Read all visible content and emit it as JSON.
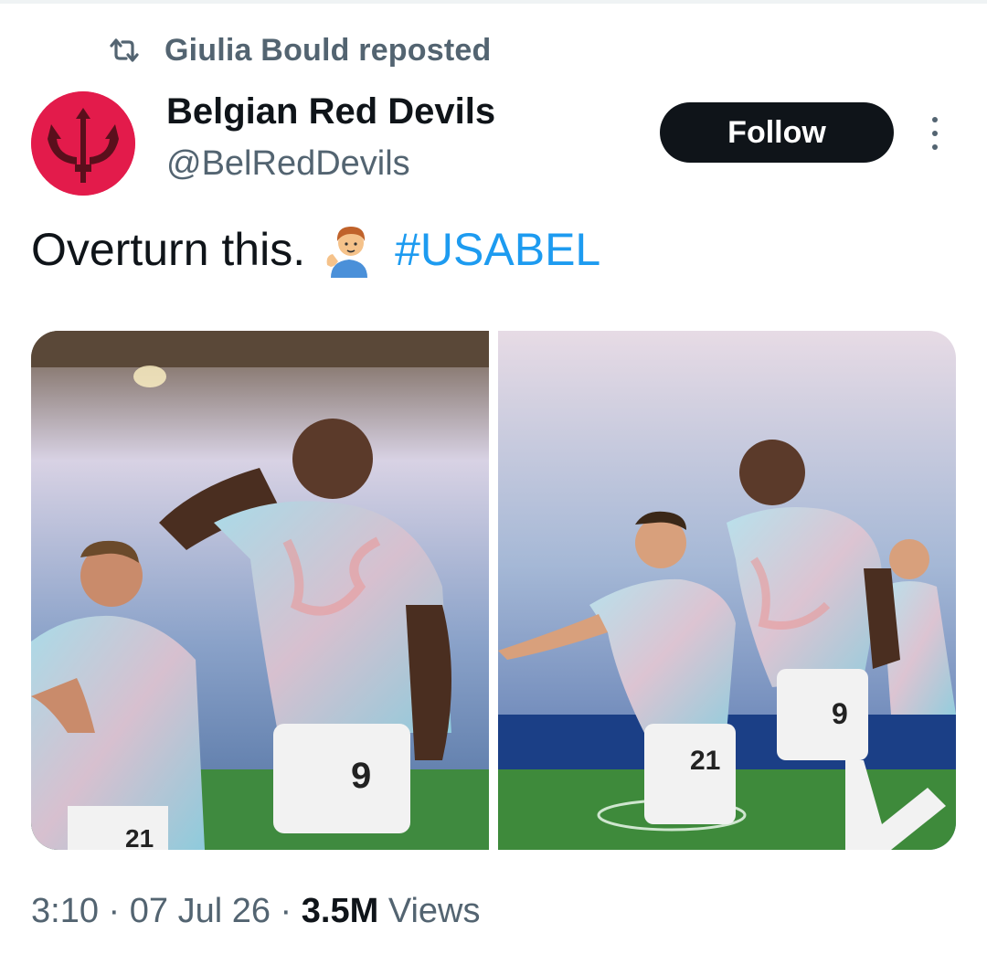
{
  "repost": {
    "text": "Giulia Bould reposted",
    "icon": "repost-icon"
  },
  "author": {
    "name": "Belgian Red Devils",
    "handle": "@BelRedDevils",
    "avatar_color": "#e31b4b",
    "avatar_icon": "trident-icon"
  },
  "follow_button": {
    "label": "Follow"
  },
  "more_button": {
    "icon": "more-vertical-icon"
  },
  "tweet": {
    "text": "Overturn this.",
    "emoji": "person-tipping-hand-emoji",
    "hashtag": "#USABEL"
  },
  "media": {
    "photos": [
      {
        "name": "photo-1",
        "jersey_numbers": [
          "9",
          "21"
        ]
      },
      {
        "name": "photo-2",
        "jersey_numbers": [
          "9",
          "21"
        ]
      }
    ]
  },
  "meta": {
    "time": "3:10",
    "separator": "·",
    "date": "07 Jul 26",
    "views_count": "3.5M",
    "views_label": "Views"
  },
  "colors": {
    "accent": "#1d9bf0",
    "text_primary": "#0f1419",
    "text_secondary": "#536471",
    "button_bg": "#0f1419"
  }
}
